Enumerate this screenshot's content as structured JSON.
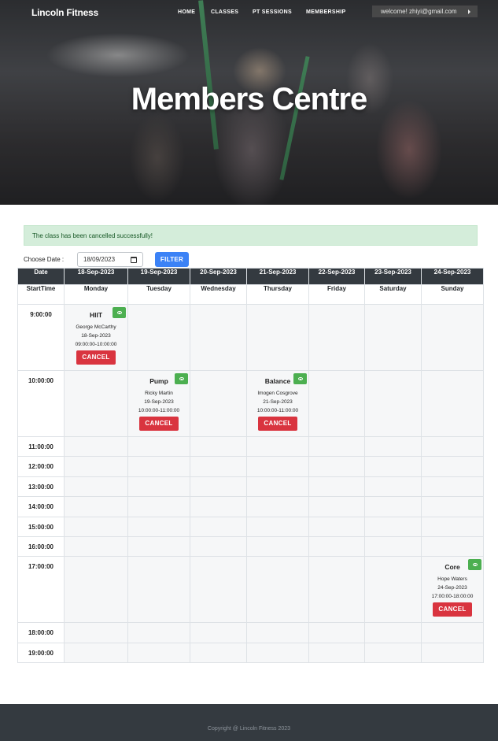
{
  "navbar": {
    "brand": "Lincoln Fitness",
    "links": [
      "HOME",
      "CLASSES",
      "PT SESSIONS",
      "MEMBERSHIP"
    ],
    "welcome": "welcome! zhiyi@gmail.com"
  },
  "hero": {
    "title": "Members Centre"
  },
  "alert": {
    "message": "The class has been cancelled successfully!",
    "color": "#d4edda"
  },
  "filter": {
    "label": "Choose Date :",
    "date_value": "18/09/2023",
    "button_label": "FILTER"
  },
  "timetable": {
    "header_date": "Date",
    "header_start": "StartTime",
    "dates": [
      "18-Sep-2023",
      "19-Sep-2023",
      "20-Sep-2023",
      "21-Sep-2023",
      "22-Sep-2023",
      "23-Sep-2023",
      "24-Sep-2023"
    ],
    "days": [
      "Monday",
      "Tuesday",
      "Wednesday",
      "Thursday",
      "Friday",
      "Saturday",
      "Sunday"
    ],
    "times": [
      "9:00:00",
      "10:00:00",
      "11:00:00",
      "12:00:00",
      "13:00:00",
      "14:00:00",
      "15:00:00",
      "16:00:00",
      "17:00:00",
      "18:00:00",
      "19:00:00"
    ],
    "classes": {
      "hiit": {
        "name": "HIIT",
        "trainer": "George McCarthy",
        "date": "18-Sep-2023",
        "time": "09:00:00-10:00:00",
        "cancel": "CANCEL"
      },
      "pump": {
        "name": "Pump",
        "trainer": "Ricky Martin",
        "date": "19-Sep-2023",
        "time": "10:00:00-11:00:00",
        "cancel": "CANCEL"
      },
      "balance": {
        "name": "Balance",
        "trainer": "Imogen Cosgrove",
        "date": "21-Sep-2023",
        "time": "10:00:00-11:00:00",
        "cancel": "CANCEL"
      },
      "core": {
        "name": "Core",
        "trainer": "Hope Waters",
        "date": "24-Sep-2023",
        "time": "17:00:00-18:00:00",
        "cancel": "CANCEL"
      }
    }
  },
  "footer": {
    "copyright": "Copyright @ Lincoln Fitness 2023"
  },
  "colors": {
    "filter_button": "#3b82f6",
    "cancel_button": "#d9343f",
    "view_button": "#4caf50",
    "table_header": "#343a40",
    "footer": "#343a40"
  },
  "icons": {
    "view": "eye-icon",
    "calendar": "calendar-icon",
    "welcome_caret": "caret-right-icon"
  }
}
